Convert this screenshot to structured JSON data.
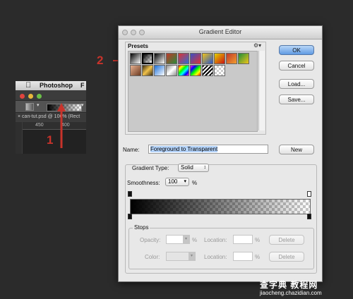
{
  "photoshop": {
    "app_name": "Photoshop",
    "menu_next": "F",
    "doc_tab": "can-tut.psd @ 100% (Rect",
    "ruler_ticks": [
      "450",
      "400"
    ]
  },
  "annotations": {
    "step1": "1",
    "step2": "2"
  },
  "dialog": {
    "title": "Gradient Editor",
    "presets_label": "Presets",
    "buttons": {
      "ok": "OK",
      "cancel": "Cancel",
      "load": "Load...",
      "save": "Save...",
      "new": "New"
    },
    "name_label": "Name:",
    "name_value": "Foreground to Transparent",
    "gradient_type_label": "Gradient Type:",
    "gradient_type_value": "Solid",
    "smoothness_label": "Smoothness:",
    "smoothness_value": "100",
    "smoothness_unit": "%",
    "stops": {
      "title": "Stops",
      "opacity_label": "Opacity:",
      "opacity_unit": "%",
      "location_label": "Location:",
      "location_unit": "%",
      "color_label": "Color:",
      "delete_label": "Delete"
    }
  },
  "watermark": {
    "line1": "查字典 教程网",
    "line2": "jiaocheng.chazidian.com"
  }
}
